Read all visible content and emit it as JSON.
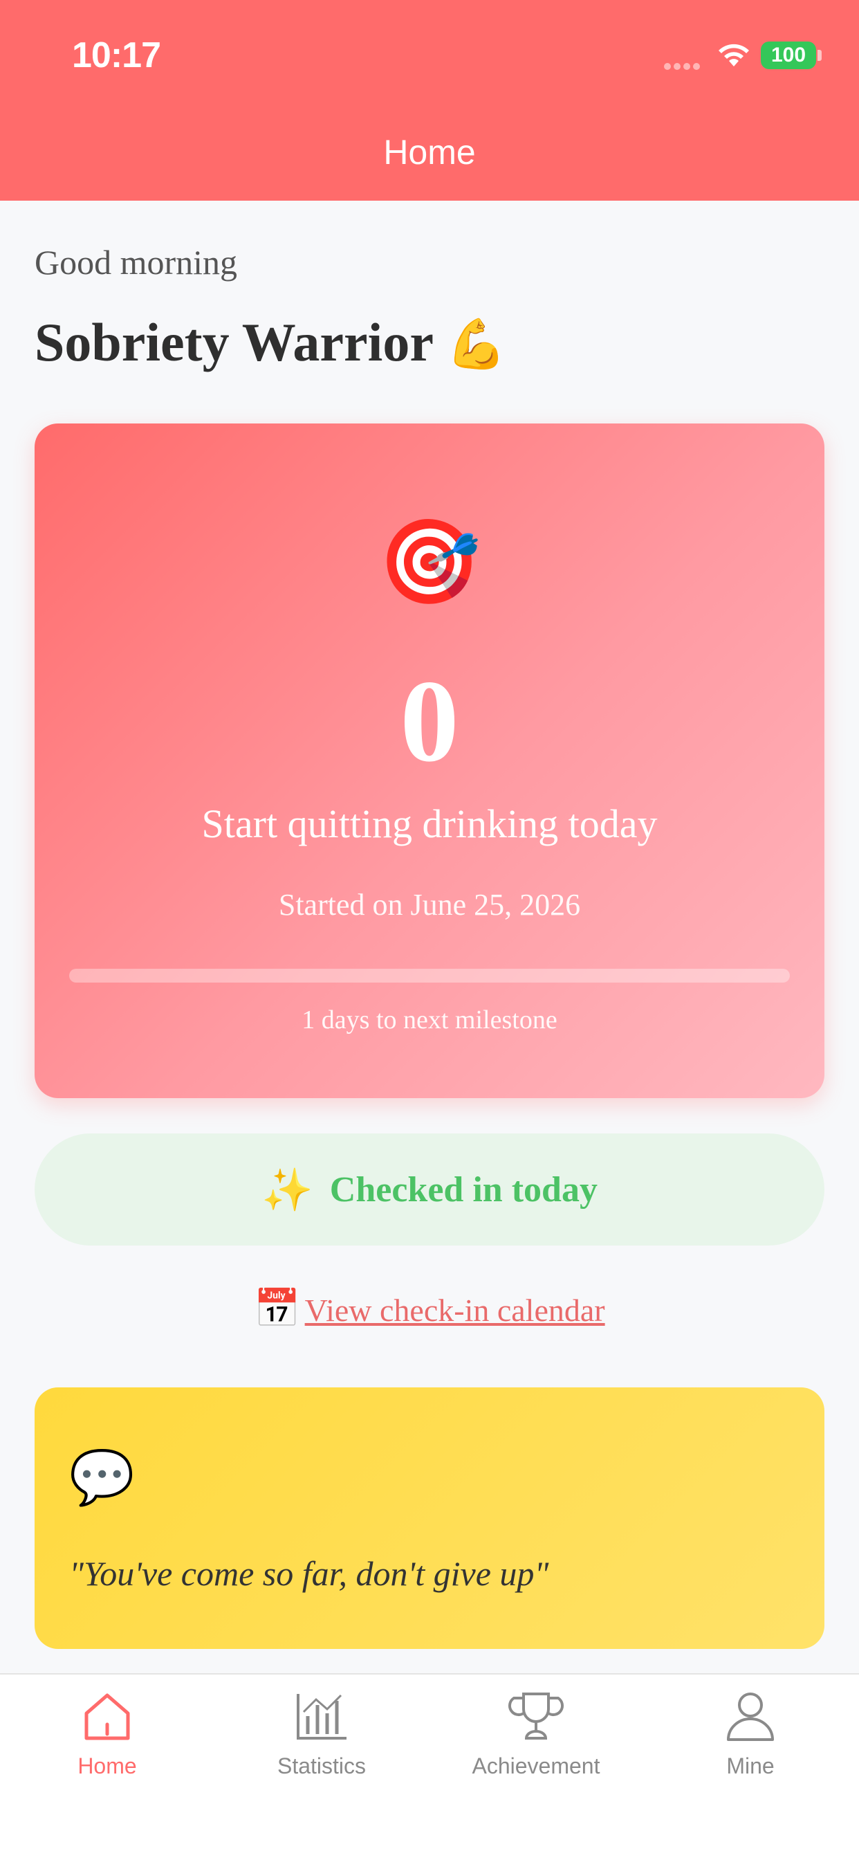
{
  "status_bar": {
    "time": "10:17",
    "battery": "100"
  },
  "nav": {
    "title": "Home"
  },
  "header": {
    "greeting": "Good morning",
    "username": "Sobriety Warrior",
    "username_emoji": "💪"
  },
  "hero": {
    "emoji": "🎯",
    "days": "0",
    "subtitle": "Start quitting drinking today",
    "started": "Started on June 25, 2026",
    "progress": 0,
    "milestone": "1 days to next milestone"
  },
  "checkin": {
    "icon": "✨",
    "label": "Checked in today"
  },
  "calendar_link": {
    "icon": "📅",
    "label": "View check-in calendar"
  },
  "quote": {
    "icon": "💬",
    "text": "\"You've come so far, don't give up\""
  },
  "tabs": [
    {
      "label": "Home",
      "icon": "home-icon",
      "active": true
    },
    {
      "label": "Statistics",
      "icon": "statistics-icon",
      "active": false
    },
    {
      "label": "Achievement",
      "icon": "trophy-icon",
      "active": false
    },
    {
      "label": "Mine",
      "icon": "user-icon",
      "active": false
    }
  ],
  "colors": {
    "brand": "#FF6B6B",
    "success": "#4CC265",
    "quote_bg": "#FFD93D"
  }
}
